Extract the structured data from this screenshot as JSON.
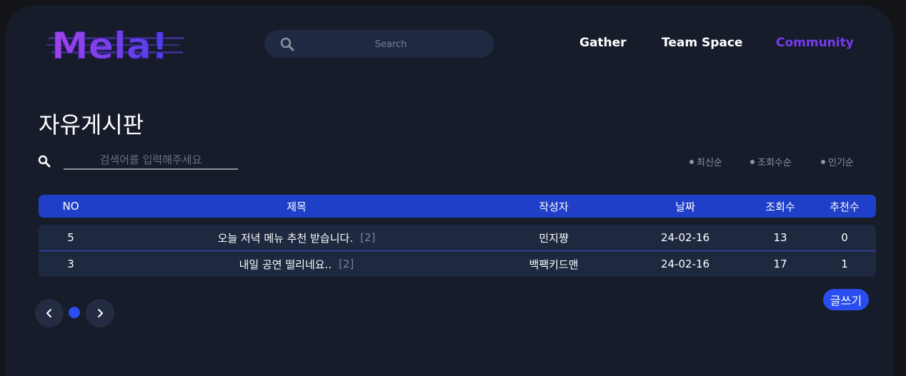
{
  "header": {
    "logo_text": "Mela!",
    "search_placeholder": "Search",
    "nav": [
      "Gather",
      "Team Space",
      "Community"
    ]
  },
  "board": {
    "title": "자유게시판",
    "search_placeholder": "검색어를 입력해주세요",
    "sort_options": [
      "최신순",
      "조회수순",
      "인기순"
    ]
  },
  "table": {
    "headers": [
      "NO",
      "제목",
      "작성자",
      "날짜",
      "조회수",
      "추천수"
    ],
    "rows": [
      {
        "no": "5",
        "title": "오늘 저녁 메뉴 추천 받습니다.",
        "comments": "[2]",
        "author": "민지쨩",
        "date": "24-02-16",
        "views": "13",
        "likes": "0"
      },
      {
        "no": "3",
        "title": "내일 공연 떨리네요..",
        "comments": "[2]",
        "author": "백팩키드맨",
        "date": "24-02-16",
        "views": "17",
        "likes": "1"
      }
    ]
  },
  "pagination": {
    "current_page": 1
  },
  "write_button": "글쓰기",
  "colors": {
    "background": "#161c2a",
    "accent_purple": "#7a3af2",
    "header_blue": "#1f3fc8",
    "button_blue": "#2a4df0"
  },
  "icons": {
    "search": "magnifier-icon",
    "prev": "chevron-left-icon",
    "next": "chevron-right-icon"
  }
}
